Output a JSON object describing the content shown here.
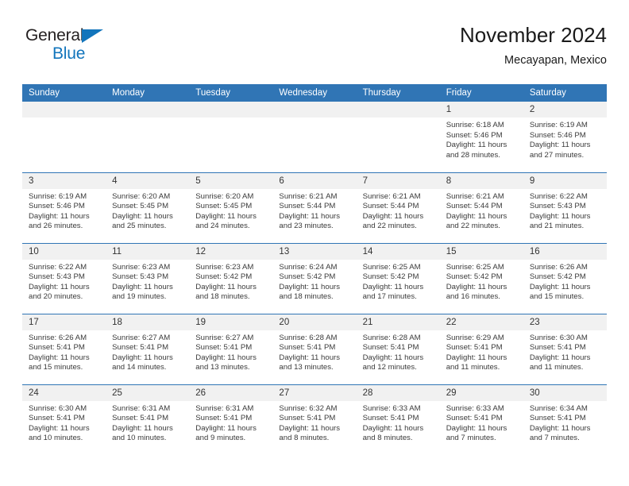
{
  "brand": {
    "name_top": "General",
    "name_bottom": "Blue",
    "accent_color": "#1275bc"
  },
  "header": {
    "title": "November 2024",
    "subtitle": "Mecayapan, Mexico"
  },
  "theme": {
    "header_blue": "#3075b5",
    "daynum_band": "#f1f1f1",
    "text": "#3a3a3a"
  },
  "weekdays": [
    "Sunday",
    "Monday",
    "Tuesday",
    "Wednesday",
    "Thursday",
    "Friday",
    "Saturday"
  ],
  "labels": {
    "sunrise": "Sunrise:",
    "sunset": "Sunset:",
    "daylight": "Daylight:"
  },
  "weeks": [
    [
      {
        "day": "",
        "empty": true
      },
      {
        "day": "",
        "empty": true
      },
      {
        "day": "",
        "empty": true
      },
      {
        "day": "",
        "empty": true
      },
      {
        "day": "",
        "empty": true
      },
      {
        "day": "1",
        "sunrise": "Sunrise: 6:18 AM",
        "sunset": "Sunset: 5:46 PM",
        "daylight1": "Daylight: 11 hours",
        "daylight2": "and 28 minutes."
      },
      {
        "day": "2",
        "sunrise": "Sunrise: 6:19 AM",
        "sunset": "Sunset: 5:46 PM",
        "daylight1": "Daylight: 11 hours",
        "daylight2": "and 27 minutes."
      }
    ],
    [
      {
        "day": "3",
        "sunrise": "Sunrise: 6:19 AM",
        "sunset": "Sunset: 5:46 PM",
        "daylight1": "Daylight: 11 hours",
        "daylight2": "and 26 minutes."
      },
      {
        "day": "4",
        "sunrise": "Sunrise: 6:20 AM",
        "sunset": "Sunset: 5:45 PM",
        "daylight1": "Daylight: 11 hours",
        "daylight2": "and 25 minutes."
      },
      {
        "day": "5",
        "sunrise": "Sunrise: 6:20 AM",
        "sunset": "Sunset: 5:45 PM",
        "daylight1": "Daylight: 11 hours",
        "daylight2": "and 24 minutes."
      },
      {
        "day": "6",
        "sunrise": "Sunrise: 6:21 AM",
        "sunset": "Sunset: 5:44 PM",
        "daylight1": "Daylight: 11 hours",
        "daylight2": "and 23 minutes."
      },
      {
        "day": "7",
        "sunrise": "Sunrise: 6:21 AM",
        "sunset": "Sunset: 5:44 PM",
        "daylight1": "Daylight: 11 hours",
        "daylight2": "and 22 minutes."
      },
      {
        "day": "8",
        "sunrise": "Sunrise: 6:21 AM",
        "sunset": "Sunset: 5:44 PM",
        "daylight1": "Daylight: 11 hours",
        "daylight2": "and 22 minutes."
      },
      {
        "day": "9",
        "sunrise": "Sunrise: 6:22 AM",
        "sunset": "Sunset: 5:43 PM",
        "daylight1": "Daylight: 11 hours",
        "daylight2": "and 21 minutes."
      }
    ],
    [
      {
        "day": "10",
        "sunrise": "Sunrise: 6:22 AM",
        "sunset": "Sunset: 5:43 PM",
        "daylight1": "Daylight: 11 hours",
        "daylight2": "and 20 minutes."
      },
      {
        "day": "11",
        "sunrise": "Sunrise: 6:23 AM",
        "sunset": "Sunset: 5:43 PM",
        "daylight1": "Daylight: 11 hours",
        "daylight2": "and 19 minutes."
      },
      {
        "day": "12",
        "sunrise": "Sunrise: 6:23 AM",
        "sunset": "Sunset: 5:42 PM",
        "daylight1": "Daylight: 11 hours",
        "daylight2": "and 18 minutes."
      },
      {
        "day": "13",
        "sunrise": "Sunrise: 6:24 AM",
        "sunset": "Sunset: 5:42 PM",
        "daylight1": "Daylight: 11 hours",
        "daylight2": "and 18 minutes."
      },
      {
        "day": "14",
        "sunrise": "Sunrise: 6:25 AM",
        "sunset": "Sunset: 5:42 PM",
        "daylight1": "Daylight: 11 hours",
        "daylight2": "and 17 minutes."
      },
      {
        "day": "15",
        "sunrise": "Sunrise: 6:25 AM",
        "sunset": "Sunset: 5:42 PM",
        "daylight1": "Daylight: 11 hours",
        "daylight2": "and 16 minutes."
      },
      {
        "day": "16",
        "sunrise": "Sunrise: 6:26 AM",
        "sunset": "Sunset: 5:42 PM",
        "daylight1": "Daylight: 11 hours",
        "daylight2": "and 15 minutes."
      }
    ],
    [
      {
        "day": "17",
        "sunrise": "Sunrise: 6:26 AM",
        "sunset": "Sunset: 5:41 PM",
        "daylight1": "Daylight: 11 hours",
        "daylight2": "and 15 minutes."
      },
      {
        "day": "18",
        "sunrise": "Sunrise: 6:27 AM",
        "sunset": "Sunset: 5:41 PM",
        "daylight1": "Daylight: 11 hours",
        "daylight2": "and 14 minutes."
      },
      {
        "day": "19",
        "sunrise": "Sunrise: 6:27 AM",
        "sunset": "Sunset: 5:41 PM",
        "daylight1": "Daylight: 11 hours",
        "daylight2": "and 13 minutes."
      },
      {
        "day": "20",
        "sunrise": "Sunrise: 6:28 AM",
        "sunset": "Sunset: 5:41 PM",
        "daylight1": "Daylight: 11 hours",
        "daylight2": "and 13 minutes."
      },
      {
        "day": "21",
        "sunrise": "Sunrise: 6:28 AM",
        "sunset": "Sunset: 5:41 PM",
        "daylight1": "Daylight: 11 hours",
        "daylight2": "and 12 minutes."
      },
      {
        "day": "22",
        "sunrise": "Sunrise: 6:29 AM",
        "sunset": "Sunset: 5:41 PM",
        "daylight1": "Daylight: 11 hours",
        "daylight2": "and 11 minutes."
      },
      {
        "day": "23",
        "sunrise": "Sunrise: 6:30 AM",
        "sunset": "Sunset: 5:41 PM",
        "daylight1": "Daylight: 11 hours",
        "daylight2": "and 11 minutes."
      }
    ],
    [
      {
        "day": "24",
        "sunrise": "Sunrise: 6:30 AM",
        "sunset": "Sunset: 5:41 PM",
        "daylight1": "Daylight: 11 hours",
        "daylight2": "and 10 minutes."
      },
      {
        "day": "25",
        "sunrise": "Sunrise: 6:31 AM",
        "sunset": "Sunset: 5:41 PM",
        "daylight1": "Daylight: 11 hours",
        "daylight2": "and 10 minutes."
      },
      {
        "day": "26",
        "sunrise": "Sunrise: 6:31 AM",
        "sunset": "Sunset: 5:41 PM",
        "daylight1": "Daylight: 11 hours",
        "daylight2": "and 9 minutes."
      },
      {
        "day": "27",
        "sunrise": "Sunrise: 6:32 AM",
        "sunset": "Sunset: 5:41 PM",
        "daylight1": "Daylight: 11 hours",
        "daylight2": "and 8 minutes."
      },
      {
        "day": "28",
        "sunrise": "Sunrise: 6:33 AM",
        "sunset": "Sunset: 5:41 PM",
        "daylight1": "Daylight: 11 hours",
        "daylight2": "and 8 minutes."
      },
      {
        "day": "29",
        "sunrise": "Sunrise: 6:33 AM",
        "sunset": "Sunset: 5:41 PM",
        "daylight1": "Daylight: 11 hours",
        "daylight2": "and 7 minutes."
      },
      {
        "day": "30",
        "sunrise": "Sunrise: 6:34 AM",
        "sunset": "Sunset: 5:41 PM",
        "daylight1": "Daylight: 11 hours",
        "daylight2": "and 7 minutes."
      }
    ]
  ]
}
